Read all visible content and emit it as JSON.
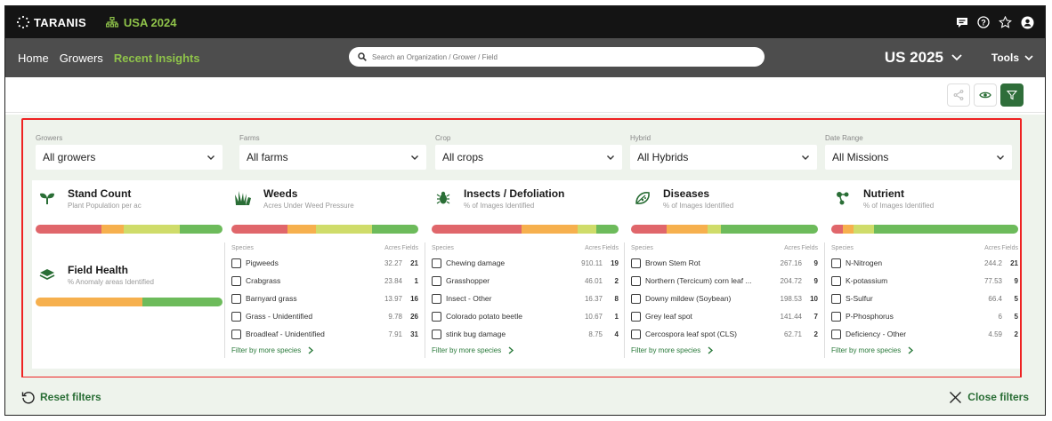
{
  "app": {
    "brand": "TARANIS",
    "org": "USA 2024"
  },
  "nav": {
    "home": "Home",
    "growers": "Growers",
    "recent": "Recent Insights",
    "search_placeholder": "Search an Organization / Grower / Field",
    "season": "US 2025",
    "tools": "Tools"
  },
  "filters": [
    {
      "label": "Growers",
      "value": "All growers"
    },
    {
      "label": "Farms",
      "value": "All farms"
    },
    {
      "label": "Crop",
      "value": "All crops"
    },
    {
      "label": "Hybrid",
      "value": "All Hybrids"
    },
    {
      "label": "Date Range",
      "value": "All Missions"
    }
  ],
  "species_header": {
    "species": "Species",
    "acres": "Acres",
    "fields": "Fields"
  },
  "filter_more": "Filter by more species",
  "stand_count": {
    "title": "Stand Count",
    "subtitle": "Plant Population per ac",
    "bar": [
      {
        "color": "#e0666b",
        "pct": 35
      },
      {
        "color": "#f6b04e",
        "pct": 12
      },
      {
        "color": "#cfdc6a",
        "pct": 30
      },
      {
        "color": "#6dbb5b",
        "pct": 23
      }
    ]
  },
  "field_health": {
    "title": "Field Health",
    "subtitle": "% Anomaly areas Identified",
    "bar": [
      {
        "color": "#f6b04e",
        "pct": 57
      },
      {
        "color": "#6dbb5b",
        "pct": 43
      }
    ]
  },
  "weeds": {
    "title": "Weeds",
    "subtitle": "Acres Under Weed Pressure",
    "bar": [
      {
        "color": "#e0666b",
        "pct": 30
      },
      {
        "color": "#f6b04e",
        "pct": 15
      },
      {
        "color": "#cfdc6a",
        "pct": 30
      },
      {
        "color": "#6dbb5b",
        "pct": 25
      }
    ],
    "rows": [
      {
        "name": "Pigweeds",
        "acres": "32.27",
        "fields": "21"
      },
      {
        "name": "Crabgrass",
        "acres": "23.84",
        "fields": "1"
      },
      {
        "name": "Barnyard grass",
        "acres": "13.97",
        "fields": "16"
      },
      {
        "name": "Grass - Unidentified",
        "acres": "9.78",
        "fields": "26"
      },
      {
        "name": "Broadleaf - Unidentified",
        "acres": "7.91",
        "fields": "31"
      }
    ]
  },
  "insects": {
    "title": "Insects / Defoliation",
    "subtitle": "% of Images Identified",
    "bar": [
      {
        "color": "#e0666b",
        "pct": 48
      },
      {
        "color": "#f6b04e",
        "pct": 30
      },
      {
        "color": "#cfdc6a",
        "pct": 10
      },
      {
        "color": "#6dbb5b",
        "pct": 12
      }
    ],
    "rows": [
      {
        "name": "Chewing damage",
        "acres": "910.11",
        "fields": "19"
      },
      {
        "name": "Grasshopper",
        "acres": "46.01",
        "fields": "2"
      },
      {
        "name": "Insect - Other",
        "acres": "16.37",
        "fields": "8"
      },
      {
        "name": "Colorado potato beetle",
        "acres": "10.67",
        "fields": "1"
      },
      {
        "name": "stink bug damage",
        "acres": "8.75",
        "fields": "4"
      }
    ]
  },
  "diseases": {
    "title": "Diseases",
    "subtitle": "% of Images Identified",
    "bar": [
      {
        "color": "#e0666b",
        "pct": 19
      },
      {
        "color": "#f6b04e",
        "pct": 22
      },
      {
        "color": "#cfdc6a",
        "pct": 7
      },
      {
        "color": "#6dbb5b",
        "pct": 52
      }
    ],
    "rows": [
      {
        "name": "Brown Stem Rot",
        "acres": "267.16",
        "fields": "9"
      },
      {
        "name": "Northern (Tercicum) corn leaf ...",
        "acres": "204.72",
        "fields": "9"
      },
      {
        "name": "Downy mildew (Soybean)",
        "acres": "198.53",
        "fields": "10"
      },
      {
        "name": "Grey leaf spot",
        "acres": "141.44",
        "fields": "7"
      },
      {
        "name": "Cercospora leaf spot (CLS)",
        "acres": "62.71",
        "fields": "2"
      }
    ]
  },
  "nutrient": {
    "title": "Nutrient",
    "subtitle": "% of Images Identified",
    "bar": [
      {
        "color": "#e0666b",
        "pct": 6
      },
      {
        "color": "#f6b04e",
        "pct": 6
      },
      {
        "color": "#cfdc6a",
        "pct": 11
      },
      {
        "color": "#6dbb5b",
        "pct": 77
      }
    ],
    "rows": [
      {
        "name": "N-Nitrogen",
        "acres": "244.2",
        "fields": "21"
      },
      {
        "name": "K-potassium",
        "acres": "77.53",
        "fields": "9"
      },
      {
        "name": "S-Sulfur",
        "acres": "66.4",
        "fields": "5"
      },
      {
        "name": "P-Phosphorus",
        "acres": "6",
        "fields": "5"
      },
      {
        "name": "Deficiency - Other",
        "acres": "4.59",
        "fields": "2"
      }
    ]
  },
  "footer": {
    "reset": "Reset filters",
    "close": "Close filters"
  }
}
